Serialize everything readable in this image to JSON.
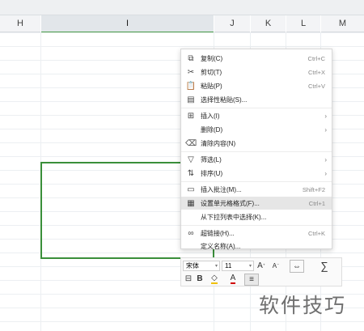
{
  "columns": [
    "H",
    "I",
    "J",
    "K",
    "L",
    "M"
  ],
  "context_menu": {
    "items": [
      {
        "label": "复制(C)",
        "shortcut": "Ctrl+C",
        "icon": "copy-icon"
      },
      {
        "label": "剪切(T)",
        "shortcut": "Ctrl+X",
        "icon": "scissors-icon"
      },
      {
        "label": "粘贴(P)",
        "shortcut": "Ctrl+V",
        "icon": "paste-icon"
      },
      {
        "label": "选择性粘贴(S)...",
        "shortcut": "",
        "icon": "paste-special-icon"
      },
      {
        "label": "插入(I)",
        "shortcut": "",
        "icon": "insert-icon",
        "submenu": true
      },
      {
        "label": "删除(D)",
        "shortcut": "",
        "icon": "",
        "submenu": true
      },
      {
        "label": "清除内容(N)",
        "shortcut": "",
        "icon": "eraser-icon"
      },
      {
        "label": "筛选(L)",
        "shortcut": "",
        "icon": "filter-icon",
        "submenu": true
      },
      {
        "label": "排序(U)",
        "shortcut": "",
        "icon": "sort-icon",
        "submenu": true
      },
      {
        "label": "插入批注(M)...",
        "shortcut": "Shift+F2",
        "icon": "comment-icon"
      },
      {
        "label": "设置单元格格式(F)...",
        "shortcut": "Ctrl+1",
        "icon": "format-cells-icon",
        "highlighted": true
      },
      {
        "label": "从下拉列表中选择(K)...",
        "shortcut": "",
        "icon": ""
      },
      {
        "label": "超链接(H)...",
        "shortcut": "Ctrl+K",
        "icon": "link-icon"
      },
      {
        "label": "定义名称(A)...",
        "shortcut": "",
        "icon": ""
      }
    ],
    "submenu_arrow": "›"
  },
  "mini_toolbar": {
    "font_name": "宋体",
    "font_size": "11",
    "dropdown": "▾",
    "grow_font": "A",
    "shrink_font": "A",
    "grow_font_mark": "⁺",
    "shrink_font_mark": "⁻",
    "bold": "B",
    "font_color": "A",
    "fill_color": "◇",
    "align": "≡",
    "wrap": "⇔",
    "sum": "∑"
  },
  "watermark": "软件技巧"
}
